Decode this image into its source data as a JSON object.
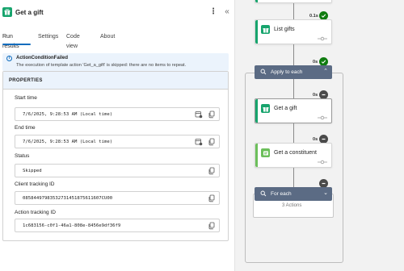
{
  "header": {
    "title": "Get a gift",
    "more_label": "⋮",
    "collapse_label": "«"
  },
  "tabs": [
    {
      "label": "Run results",
      "active": true
    },
    {
      "label": "Settings",
      "active": false
    },
    {
      "label": "Code view",
      "active": false
    },
    {
      "label": "About",
      "active": false
    }
  ],
  "info": {
    "title": "ActionConditionFailed",
    "text": "The execution of template action 'Get_a_gift' is skipped: there are no items to repeat."
  },
  "properties": {
    "heading": "PROPERTIES",
    "fields": [
      {
        "label": "Start time",
        "value": "7/6/2025, 9:28:53 AM (Local time)",
        "has_tz": true
      },
      {
        "label": "End time",
        "value": "7/6/2025, 9:28:53 AM (Local time)",
        "has_tz": true
      },
      {
        "label": "Status",
        "value": "Skipped",
        "has_tz": false
      },
      {
        "label": "Client tracking ID",
        "value": "08584497983532731451875611607CU00",
        "has_tz": false
      },
      {
        "label": "Action tracking ID",
        "value": "1c683156-c0f1-46a1-808e-8456e9df36f9",
        "has_tz": false
      }
    ]
  },
  "flow": {
    "top_time": "0.1s",
    "list_gifts": {
      "label": "List gifts",
      "time": "0s"
    },
    "apply_to_each": {
      "label": "Apply to each",
      "time": "0s"
    },
    "get_a_gift": {
      "label": "Get a gift",
      "time": "0s"
    },
    "get_constituent": {
      "label": "Get a constituent",
      "time": "0s"
    },
    "for_each": {
      "label": "For each",
      "count_label": "3 Actions"
    }
  },
  "colors": {
    "accent": "#0f6cbd",
    "success": "#107c10",
    "skipped": "#4a4a4a",
    "app_green": "#17a46d",
    "scope_header": "#5b6b84",
    "info_bg": "#ebf3fc"
  }
}
